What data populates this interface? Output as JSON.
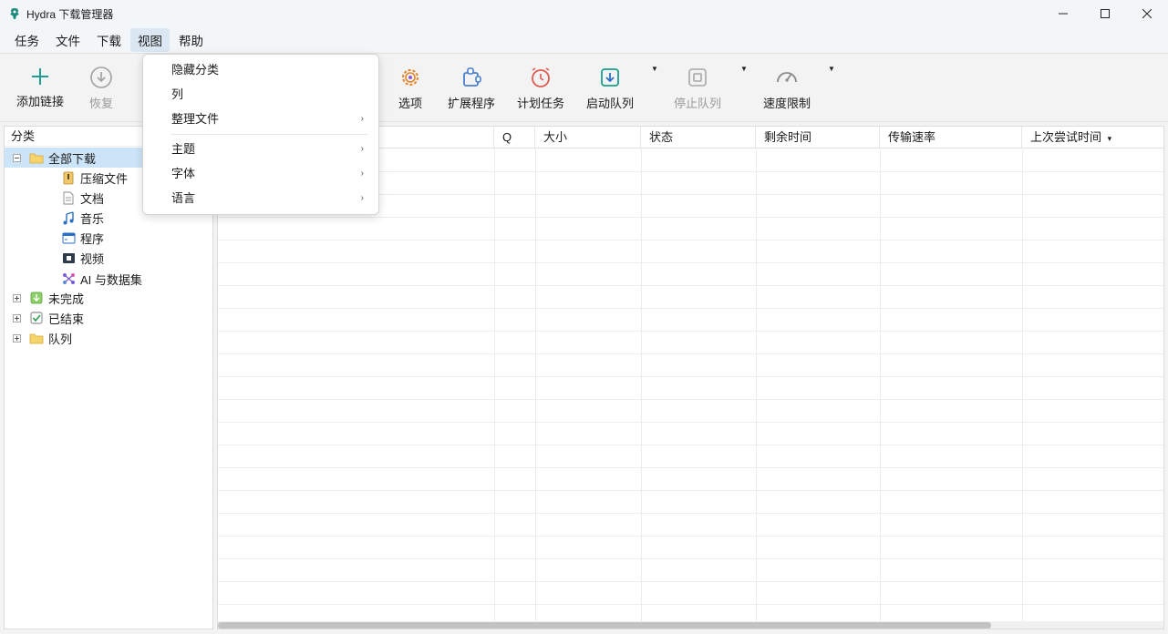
{
  "window": {
    "title": "Hydra 下载管理器"
  },
  "menubar": {
    "items": [
      "任务",
      "文件",
      "下载",
      "视图",
      "帮助"
    ]
  },
  "toolbar": {
    "add_link": "添加链接",
    "resume": "恢复",
    "options": "选项",
    "extensions": "扩展程序",
    "scheduler": "计划任务",
    "start_queue": "启动队列",
    "stop_queue": "停止队列",
    "speed_limit": "速度限制"
  },
  "view_menu": {
    "items": [
      "隐藏分类",
      "列",
      "整理文件",
      "主题",
      "字体",
      "语言"
    ],
    "submenu_arrow": "›"
  },
  "categories": {
    "header": "分类",
    "all_downloads": "全部下载",
    "children": [
      "压缩文件",
      "文档",
      "音乐",
      "程序",
      "视频",
      "AI 与数据集"
    ],
    "unfinished": "未完成",
    "finished": "已结束",
    "queues": "队列"
  },
  "columns": [
    "Q",
    "大小",
    "状态",
    "剩余时间",
    "传输速率",
    "上次尝试时间"
  ],
  "sort_indicator": "▾",
  "colors": {
    "accent": "#1a9e8f",
    "selection": "#cce4f7",
    "menu_active": "#dbe7f3"
  }
}
